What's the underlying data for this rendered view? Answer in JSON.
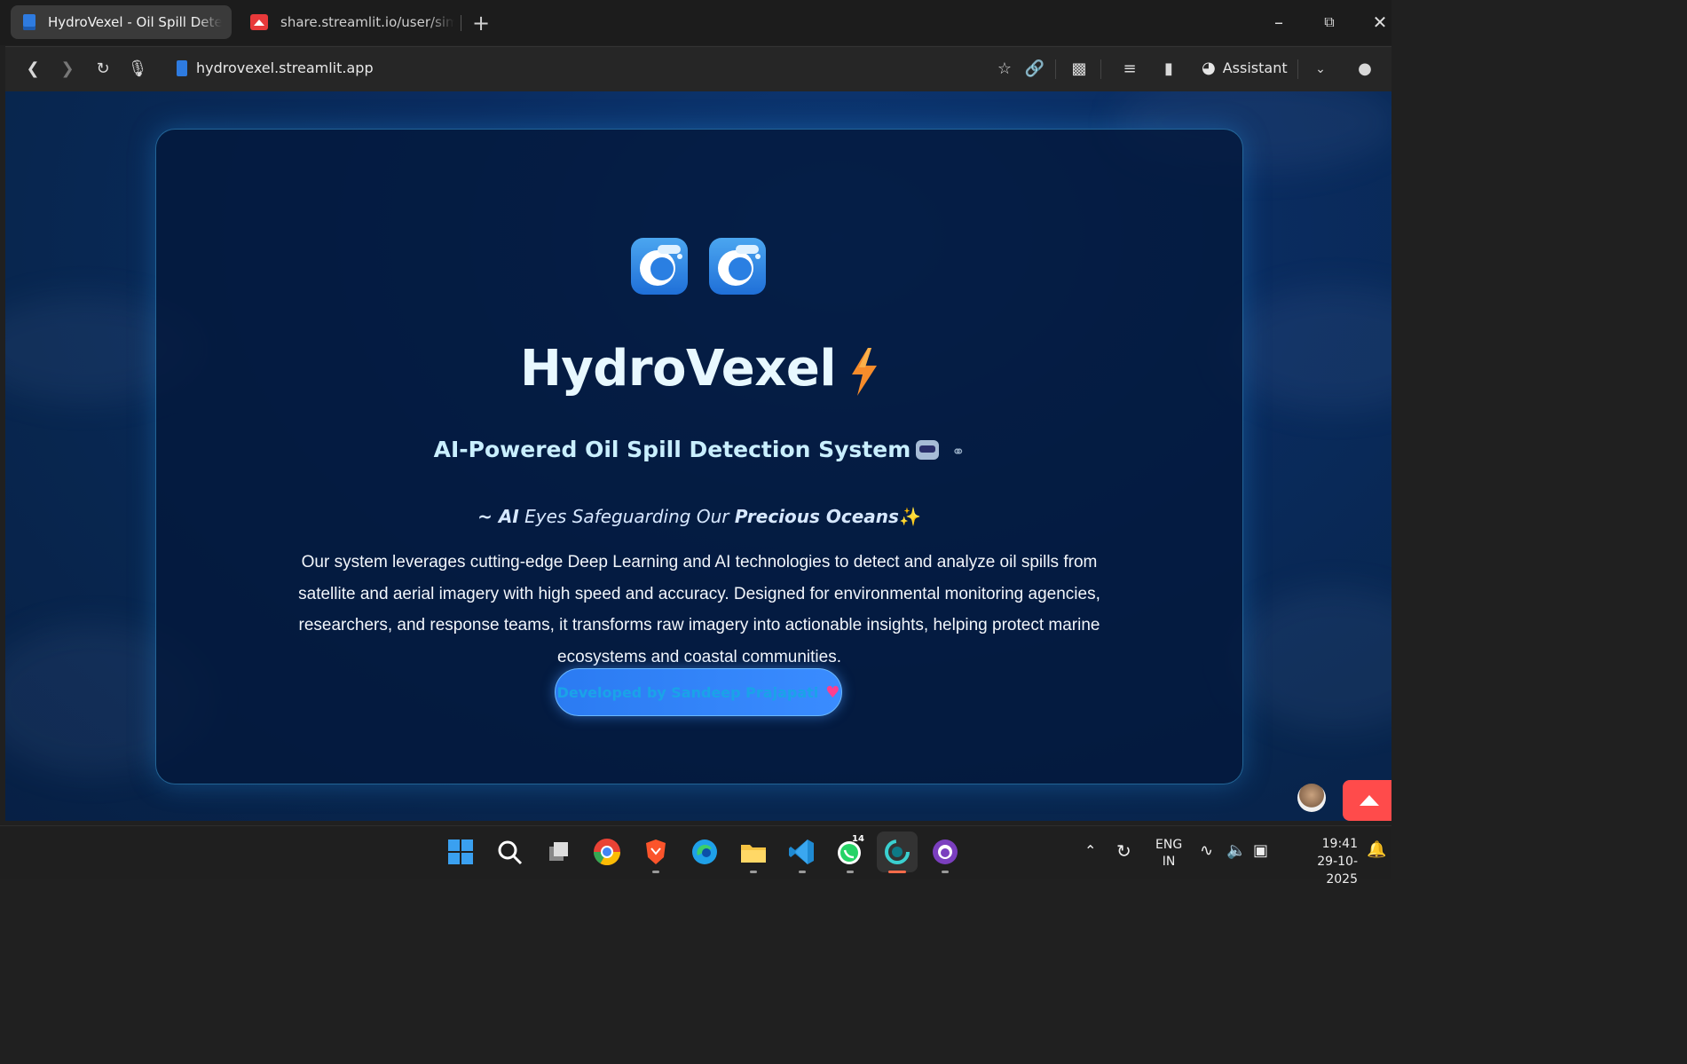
{
  "browser": {
    "tabs": [
      {
        "title": "HydroVexel - Oil Spill Detection",
        "active": true,
        "favicon": "doc-icon"
      },
      {
        "title": "share.streamlit.io/user/simplysandeepp",
        "active": false,
        "favicon": "streamlit-icon"
      }
    ],
    "url": "hydrovexel.streamlit.app",
    "assistant_label": "Assistant"
  },
  "hero": {
    "icons": [
      "wave-icon",
      "wave-icon"
    ],
    "title": "HydroVexel",
    "subtitle": "AI-Powered Oil Spill Detection System",
    "tagline_prefix": "~ ",
    "tagline_ai": "AI",
    "tagline_mid": " Eyes Safeguarding Our ",
    "tagline_bold": "Precious Oceans",
    "description": "Our system leverages cutting-edge Deep Learning and AI technologies to detect and analyze oil spills from satellite and aerial imagery with high speed and accuracy. Designed for environmental monitoring agencies, researchers, and response teams, it transforms raw imagery into actionable insights, helping protect marine ecosystems and coastal communities.",
    "developer_button": "Developed by Sandeep Prajapati"
  },
  "taskbar": {
    "whatsapp_badge": "14",
    "language": "ENG",
    "region": "IN",
    "time": "19:41",
    "date": "29-10-2025"
  },
  "colors": {
    "accent": "#2b7bf2",
    "card_border": "#3ca0dc",
    "streamlit_red": "#ff4b4b"
  }
}
